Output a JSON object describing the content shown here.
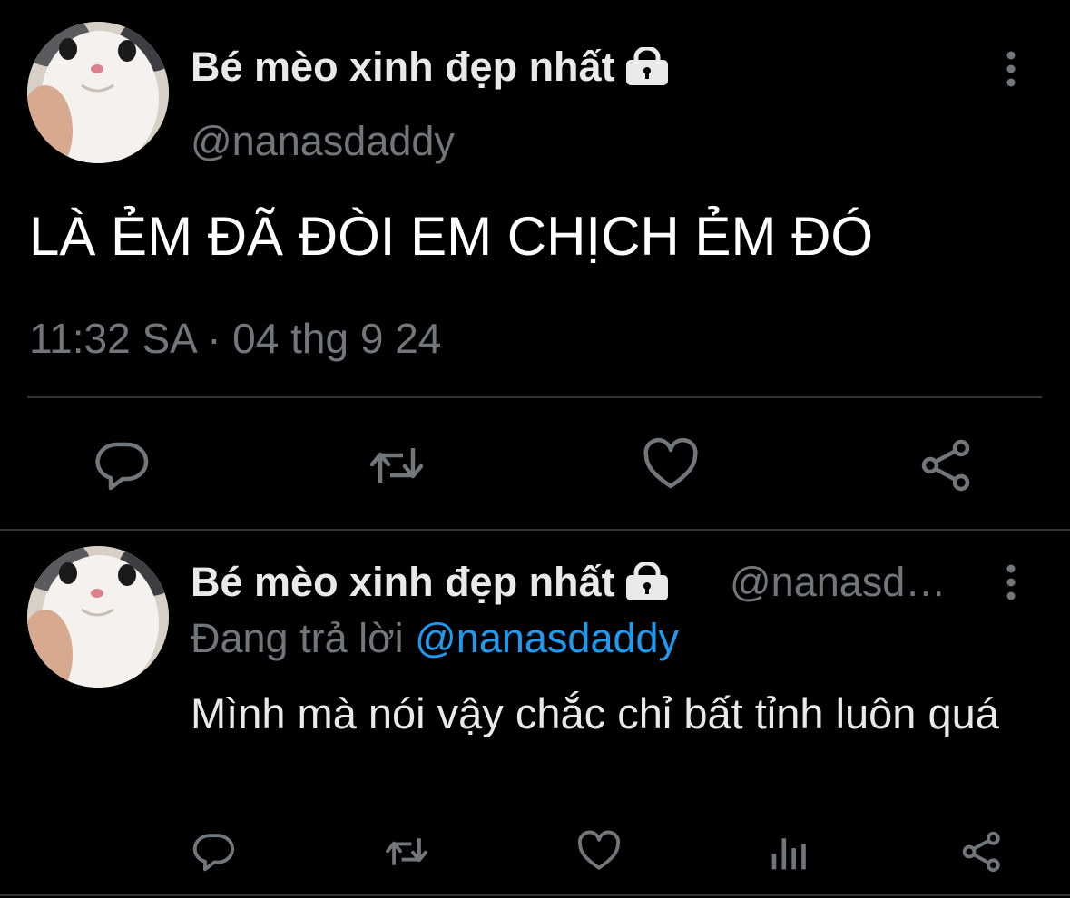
{
  "colors": {
    "background": "#000000",
    "primary_text": "#e7e9ea",
    "secondary_text": "#71767b",
    "link": "#1d9bf0",
    "divider": "#2f3336"
  },
  "main_tweet": {
    "display_name": "Bé mèo xinh đẹp nhất",
    "handle": "@nanasdaddy",
    "text": "LÀ ẺM ĐÃ ĐÒI EM CHỊCH ẺM ĐÓ",
    "timestamp": "11:32 SA · 04 thg 9 24",
    "icons": {
      "avatar": "cat-avatar",
      "protected": "lock-icon",
      "more": "more-options-icon",
      "actions": [
        "reply-icon",
        "retweet-icon",
        "like-icon",
        "share-icon"
      ]
    }
  },
  "reply_tweet": {
    "display_name": "Bé mèo xinh đẹp nhất",
    "handle": "@nanasd…",
    "replying_prefix": "Đang trả lời",
    "replying_to": "@nanasdaddy",
    "text": "Mình mà nói vậy chắc chỉ bất tỉnh luôn quá",
    "icons": {
      "avatar": "cat-avatar",
      "protected": "lock-icon",
      "more": "more-options-icon",
      "actions": [
        "reply-icon",
        "retweet-icon",
        "like-icon",
        "analytics-icon",
        "share-icon"
      ]
    }
  }
}
